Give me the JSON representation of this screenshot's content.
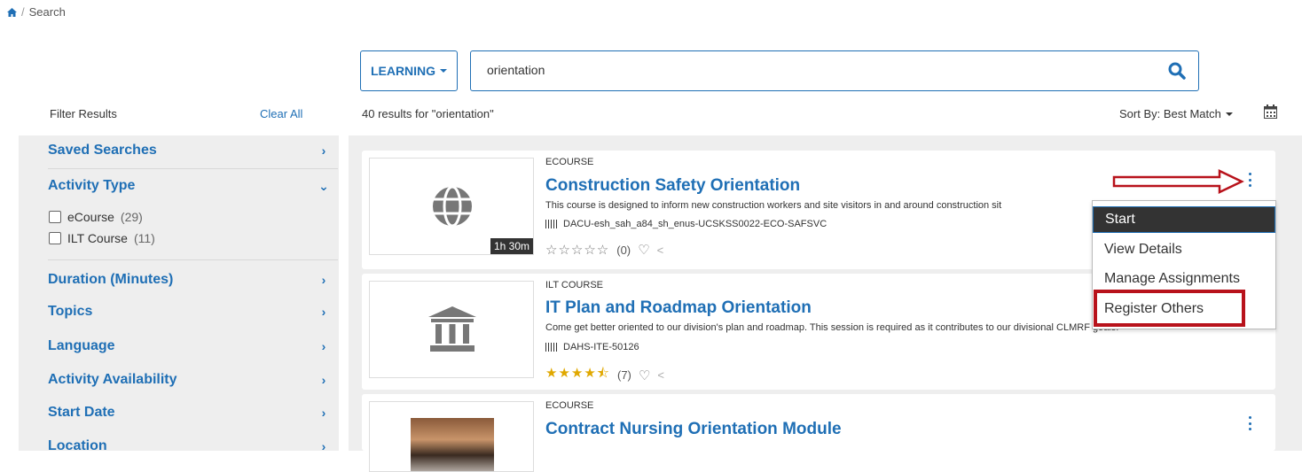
{
  "breadcrumb": {
    "current": "Search",
    "separator": "/"
  },
  "search": {
    "scope_label": "LEARNING",
    "query": "orientation"
  },
  "filters": {
    "title": "Filter Results",
    "clear_all": "Clear All",
    "sections": [
      {
        "label": "Saved Searches"
      },
      {
        "label": "Activity Type",
        "options": [
          {
            "label": "eCourse",
            "count": "(29)"
          },
          {
            "label": "ILT Course",
            "count": "(11)"
          }
        ]
      },
      {
        "label": "Duration (Minutes)"
      },
      {
        "label": "Topics"
      },
      {
        "label": "Language"
      },
      {
        "label": "Activity Availability"
      },
      {
        "label": "Start Date"
      },
      {
        "label": "Location"
      }
    ]
  },
  "results": {
    "count_text": "40 results for \"orientation\"",
    "sort_label": "Sort By: Best Match",
    "items": [
      {
        "type": "ECOURSE",
        "title": "Construction Safety Orientation",
        "description": "This course is designed to inform new construction workers and site visitors in and around construction sit",
        "code": "DACU-esh_sah_a84_sh_enus-UCSKSS0022-ECO-SAFSVC",
        "stars": "☆☆☆☆☆",
        "rating_count": "(0)",
        "duration": "1h 30m"
      },
      {
        "type": "ILT COURSE",
        "title": "IT Plan and Roadmap Orientation",
        "description": "Come get better oriented to our division's plan and roadmap. This session is required as it contributes to our divisional CLMRF goals.",
        "code": "DAHS-ITE-50126",
        "stars": "★★★★⯪",
        "rating_count": "(7)"
      },
      {
        "type": "ECOURSE",
        "title": "Contract Nursing Orientation Module"
      }
    ]
  },
  "menu": {
    "items": [
      "Start",
      "View Details",
      "Manage Assignments",
      "Register Others"
    ]
  },
  "colors": {
    "accent": "#1f6fb5",
    "highlight": "#b8121b",
    "star": "#e0a800"
  }
}
